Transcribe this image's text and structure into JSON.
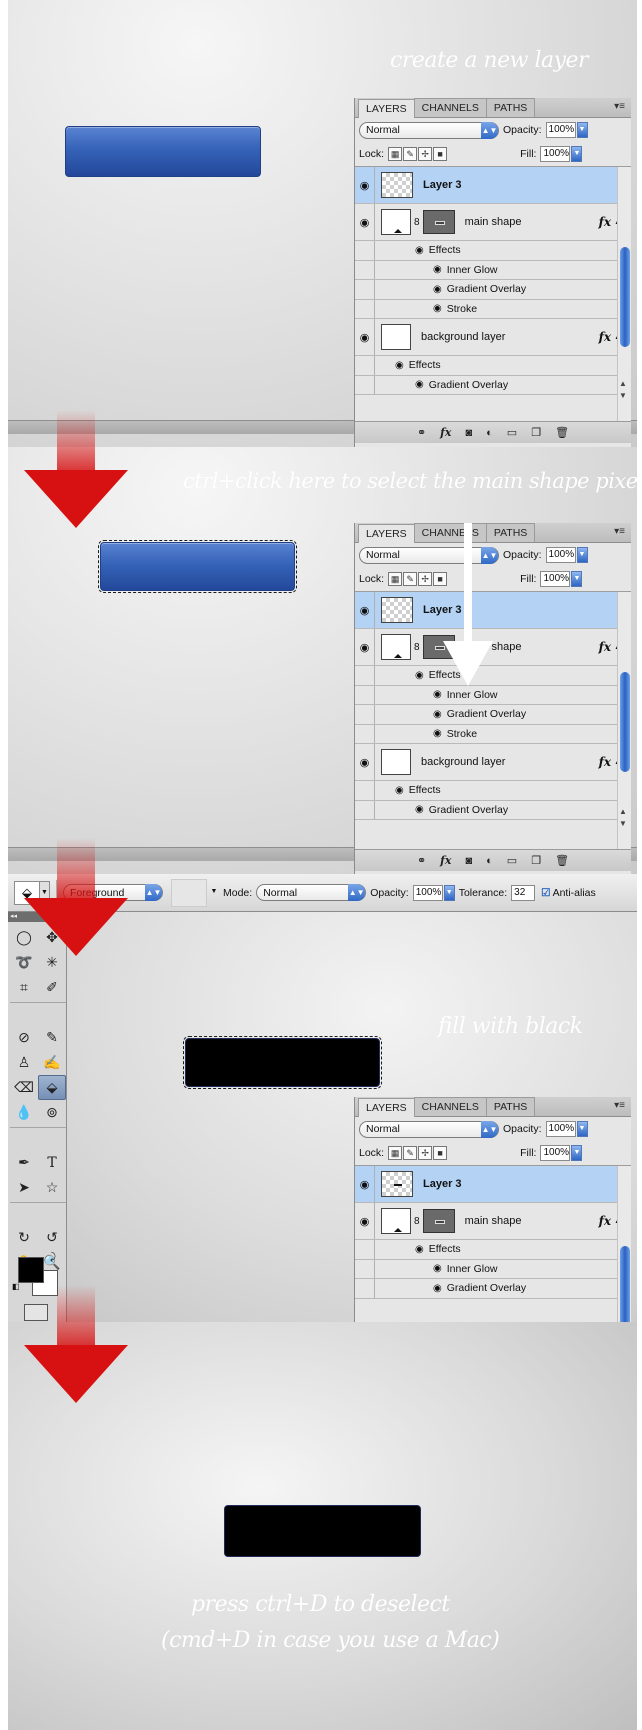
{
  "step1": {
    "caption": "create a new layer"
  },
  "step2": {
    "caption": "ctrl+click here to select the main shape pixels"
  },
  "step3": {
    "caption": "fill with black"
  },
  "step4": {
    "caption_line1": "press ctrl+D to deselect",
    "caption_line2": "(cmd+D in case you use a Mac)"
  },
  "panel": {
    "tabs": [
      "LAYERS",
      "CHANNELS",
      "PATHS"
    ],
    "menu_glyph": "▾≡",
    "blend_mode": "Normal",
    "opacity_label": "Opacity:",
    "opacity_value": "100%",
    "lock_label": "Lock:",
    "fill_label": "Fill:",
    "fill_value": "100%",
    "layers": {
      "layer3": "Layer 3",
      "main_shape": "main shape",
      "effects": "Effects",
      "inner_glow": "Inner Glow",
      "gradient_overlay": "Gradient Overlay",
      "stroke": "Stroke",
      "background": "background layer"
    },
    "fx_label": "fx",
    "footer_icons": [
      "link-icon",
      "fx-icon",
      "mask-icon",
      "adjustment-icon",
      "folder-icon",
      "new-layer-icon",
      "trash-icon"
    ],
    "colors": {
      "selection": "#b3d2f4",
      "accent_blue": "#2f68c6"
    }
  },
  "optbar": {
    "fill_source": "Foreground",
    "mode_label": "Mode:",
    "mode_value": "Normal",
    "opacity_label": "Opacity:",
    "opacity_value": "100%",
    "tolerance_label": "Tolerance:",
    "tolerance_value": "32",
    "antialias_label": "Anti-alias"
  },
  "toolbox": {
    "tools": [
      "elliptical-marquee-icon",
      "move-icon",
      "lasso-icon",
      "magic-wand-icon",
      "crop-icon",
      "eyedropper-icon",
      "healing-icon",
      "brush-icon",
      "stamp-icon",
      "history-brush-icon",
      "eraser-icon",
      "paint-bucket-icon",
      "blur-icon",
      "dodge-icon",
      "pen-icon",
      "type-icon",
      "path-select-icon",
      "shape-icon",
      "3d-rotate-icon",
      "3d-orbit-icon",
      "hand-icon",
      "zoom-icon"
    ],
    "active_tool": "paint-bucket-icon",
    "foreground_color": "#000000",
    "background_color": "#ffffff"
  },
  "colors": {
    "arrow_red": "#d71111",
    "button_blue": "#3563b8",
    "button_black": "#000000"
  }
}
